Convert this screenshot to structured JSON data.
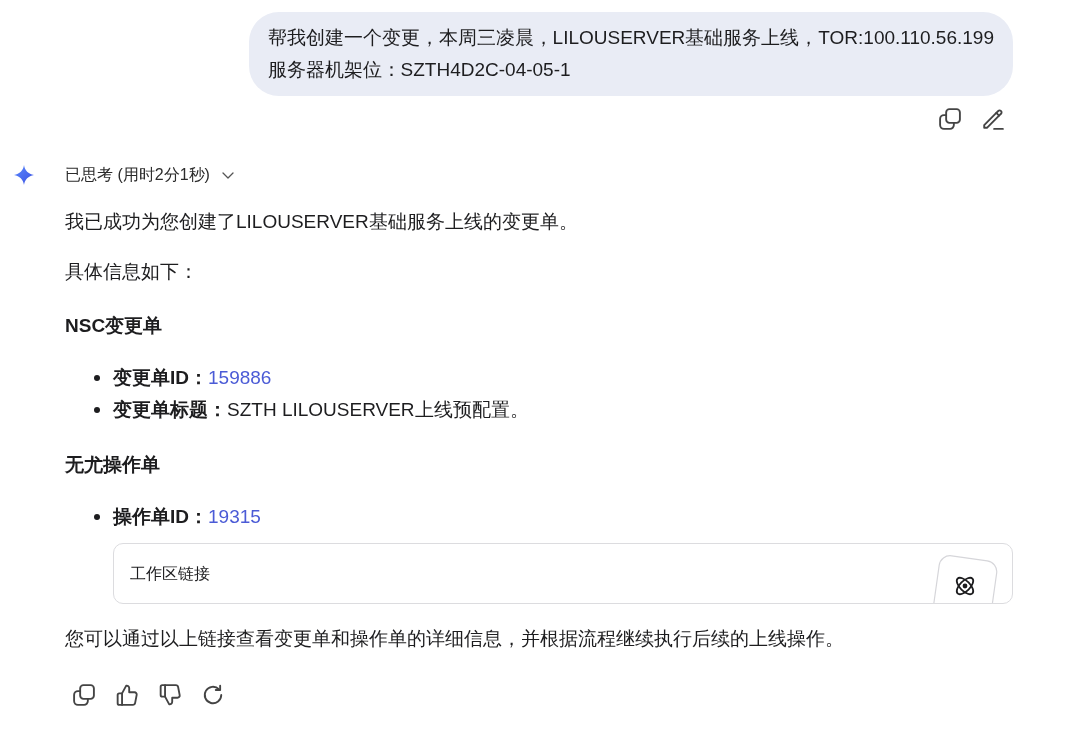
{
  "user_message": {
    "text": "帮我创建一个变更，本周三凌晨，LILOUSERVER基础服务上线，TOR:100.110.56.199\n服务器机架位：SZTH4D2C-04-05-1"
  },
  "assistant": {
    "thinking": {
      "label": "已思考 (用时2分1秒)",
      "expanded": false
    },
    "blocks": [
      {
        "kind": "paragraph",
        "text": "我已成功为您创建了LILOUSERVER基础服务上线的变更单。"
      },
      {
        "kind": "paragraph",
        "text": "具体信息如下："
      },
      {
        "kind": "heading",
        "text": "NSC变更单"
      },
      {
        "kind": "list",
        "items": [
          {
            "label": "变更单ID：",
            "value": "159886",
            "kind": "link"
          },
          {
            "label": "变更单标题：",
            "value": "SZTH LILOUSERVER上线预配置。",
            "kind": "text"
          }
        ]
      },
      {
        "kind": "heading",
        "text": "无尤操作单"
      },
      {
        "kind": "list",
        "items": [
          {
            "label": "操作单ID：",
            "value": "19315",
            "kind": "link"
          }
        ]
      },
      {
        "kind": "link_card",
        "title": "工作区链接"
      },
      {
        "kind": "paragraph",
        "text": "您可以通过以上链接查看变更单和操作单的详细信息，并根据流程继续执行后续的上线操作。"
      }
    ]
  }
}
